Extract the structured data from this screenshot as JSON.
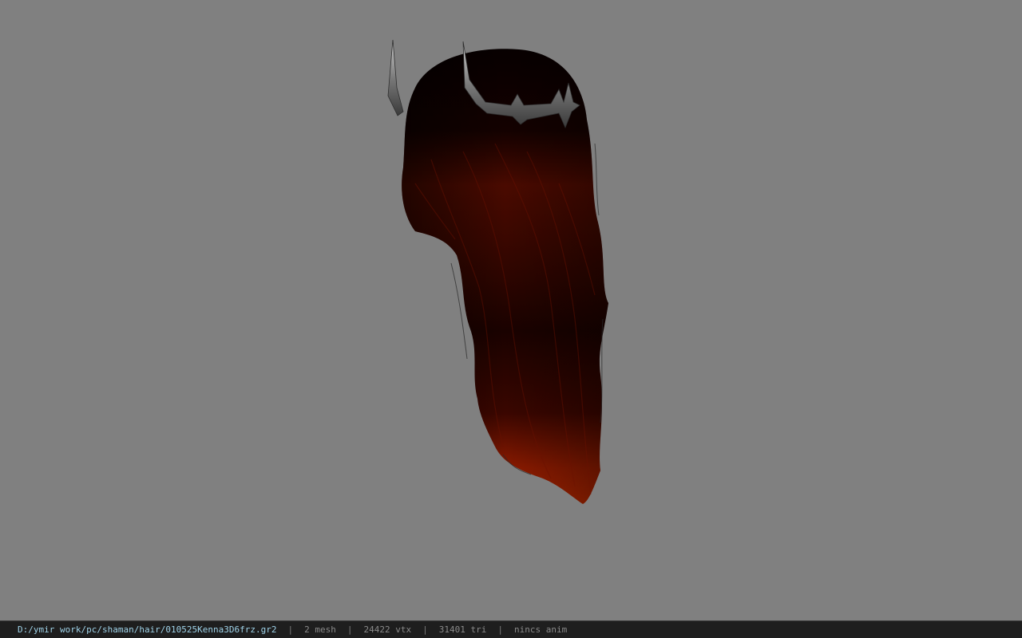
{
  "viewport": {
    "background_color": "#808080",
    "model": {
      "hair_dark_color": "#1a0200",
      "hair_mid_color": "#5a0c00",
      "hair_tip_color": "#a02000",
      "crown_color": "#9a9a9a"
    }
  },
  "status_bar": {
    "file_path": "D:/ymir work/pc/shaman/hair/010525Kenna3D6frz.gr2",
    "separator": "|",
    "mesh_count": "2 mesh",
    "vertex_count": "24422 vtx",
    "triangle_count": "31401 tri",
    "anim_state": "nincs anim"
  }
}
